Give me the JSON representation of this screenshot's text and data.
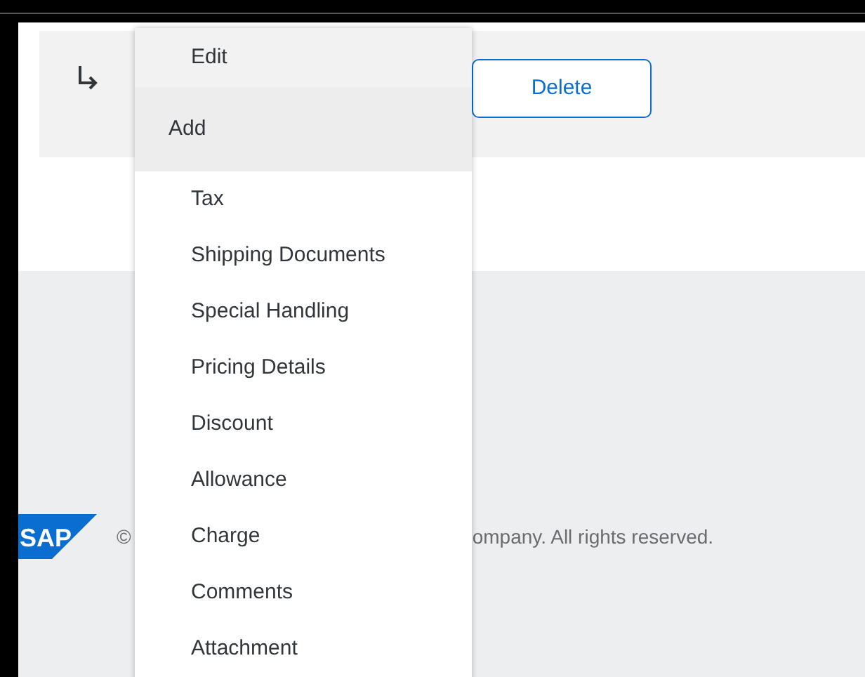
{
  "toolbar": {
    "buttons": [
      {
        "label": "Delete"
      }
    ]
  },
  "menu": {
    "items": [
      {
        "kind": "item",
        "label": "Edit",
        "highlighted": true
      },
      {
        "kind": "group",
        "label": "Add",
        "highlighted": false,
        "children": [
          {
            "label": "Tax"
          },
          {
            "label": "Shipping Documents"
          },
          {
            "label": "Special Handling"
          },
          {
            "label": "Pricing Details"
          },
          {
            "label": "Discount"
          },
          {
            "label": "Allowance"
          },
          {
            "label": "Charge"
          },
          {
            "label": "Comments"
          },
          {
            "label": "Attachment"
          }
        ]
      }
    ]
  },
  "footer": {
    "logo": "SAP",
    "copyright_mark": "©",
    "text": "ompany. All rights reserved."
  }
}
